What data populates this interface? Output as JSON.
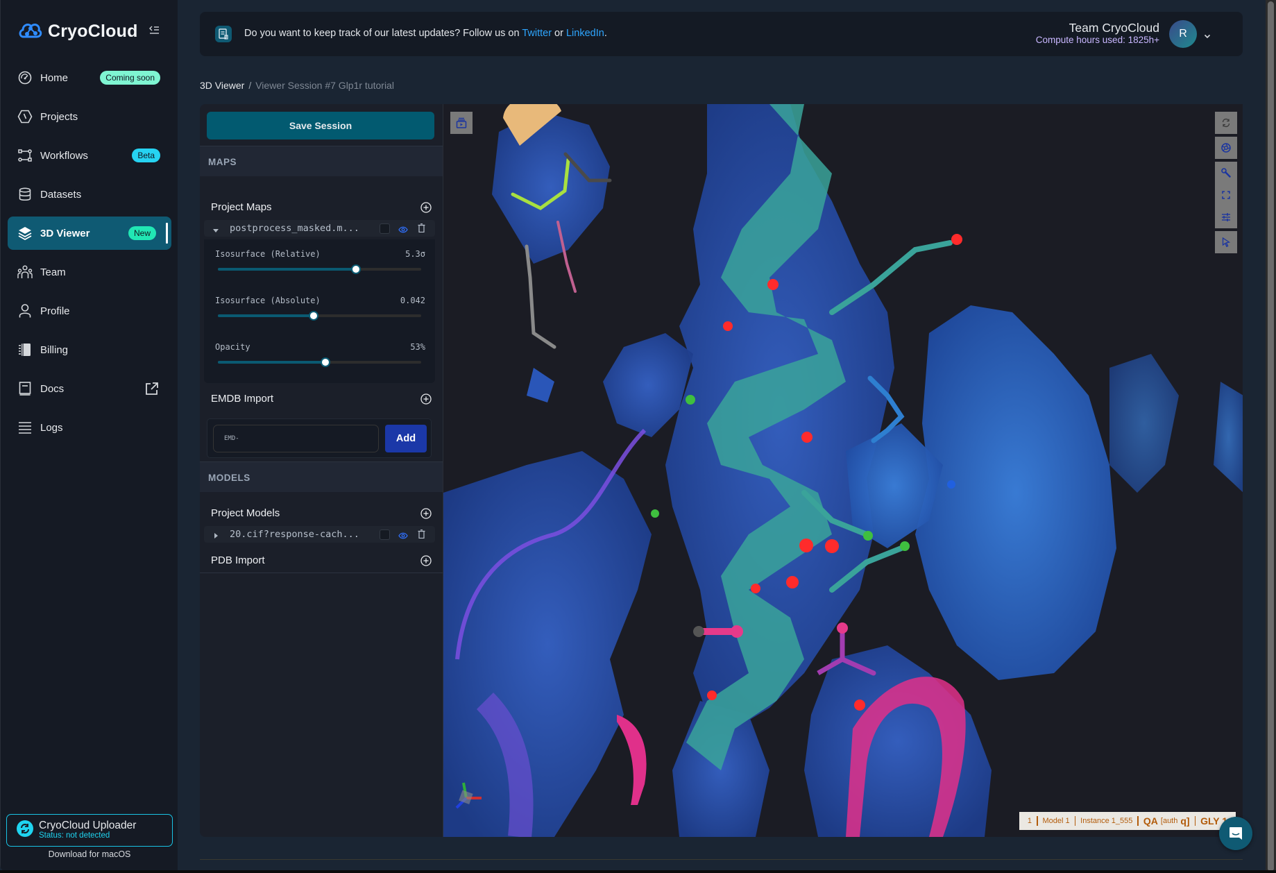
{
  "app": {
    "name": "CryoCloud"
  },
  "sidebar": {
    "items": [
      {
        "label": "Home",
        "icon": "gauge-icon",
        "badge": "Coming soon"
      },
      {
        "label": "Projects",
        "icon": "hexagon-icon"
      },
      {
        "label": "Workflows",
        "icon": "workflow-icon",
        "badge": "Beta"
      },
      {
        "label": "Datasets",
        "icon": "database-icon"
      },
      {
        "label": "3D Viewer",
        "icon": "layers-icon",
        "badge": "New",
        "active": true
      },
      {
        "label": "Team",
        "icon": "team-icon"
      },
      {
        "label": "Profile",
        "icon": "user-icon"
      },
      {
        "label": "Billing",
        "icon": "billing-icon"
      },
      {
        "label": "Docs",
        "icon": "book-icon",
        "external": true
      },
      {
        "label": "Logs",
        "icon": "list-icon"
      }
    ],
    "uploader": {
      "title": "CryoCloud Uploader",
      "status": "Status: not detected",
      "download": "Download for macOS"
    }
  },
  "banner": {
    "text_before": "Do you want to keep track of our latest updates? Follow us on ",
    "twitter": "Twitter",
    "or": " or ",
    "linkedin": "LinkedIn",
    "period": "."
  },
  "account": {
    "team": "Team CryoCloud",
    "compute": "Compute hours used: 1825h+",
    "avatar_initial": "R"
  },
  "breadcrumb": {
    "root": "3D Viewer",
    "separator": "/",
    "current": "Viewer Session #7 Glp1r tutorial"
  },
  "panel": {
    "save_label": "Save Session",
    "maps": {
      "section": "MAPS",
      "project_maps": "Project Maps",
      "file": "postprocess_masked.m...",
      "controls": [
        {
          "label": "Isosurface (Relative)",
          "value": "5.3σ",
          "fraction": 0.68
        },
        {
          "label": "Isosurface (Absolute)",
          "value": "0.042",
          "fraction": 0.47
        },
        {
          "label": "Opacity",
          "value": "53%",
          "fraction": 0.53
        }
      ],
      "emdb_title": "EMDB Import",
      "emdb_placeholder": "EMD-",
      "add_label": "Add"
    },
    "models": {
      "section": "MODELS",
      "project_models": "Project Models",
      "file": "20.cif?response-cach...",
      "pdb_title": "PDB Import"
    }
  },
  "viewer": {
    "status": {
      "p1": "1",
      "p2": "Model 1",
      "p3": "Instance 1_555",
      "p4a": "QA",
      "p4b": "[auth",
      "p4c": "q]",
      "p5": "GLY 1"
    }
  },
  "colors": {
    "accent": "#0f5a73",
    "link": "#2ea6ff",
    "badge_coming": "#7ff5d2",
    "badge_beta": "#26d3f2",
    "badge_new": "#21e6b4",
    "add_button": "#1b38a8"
  }
}
